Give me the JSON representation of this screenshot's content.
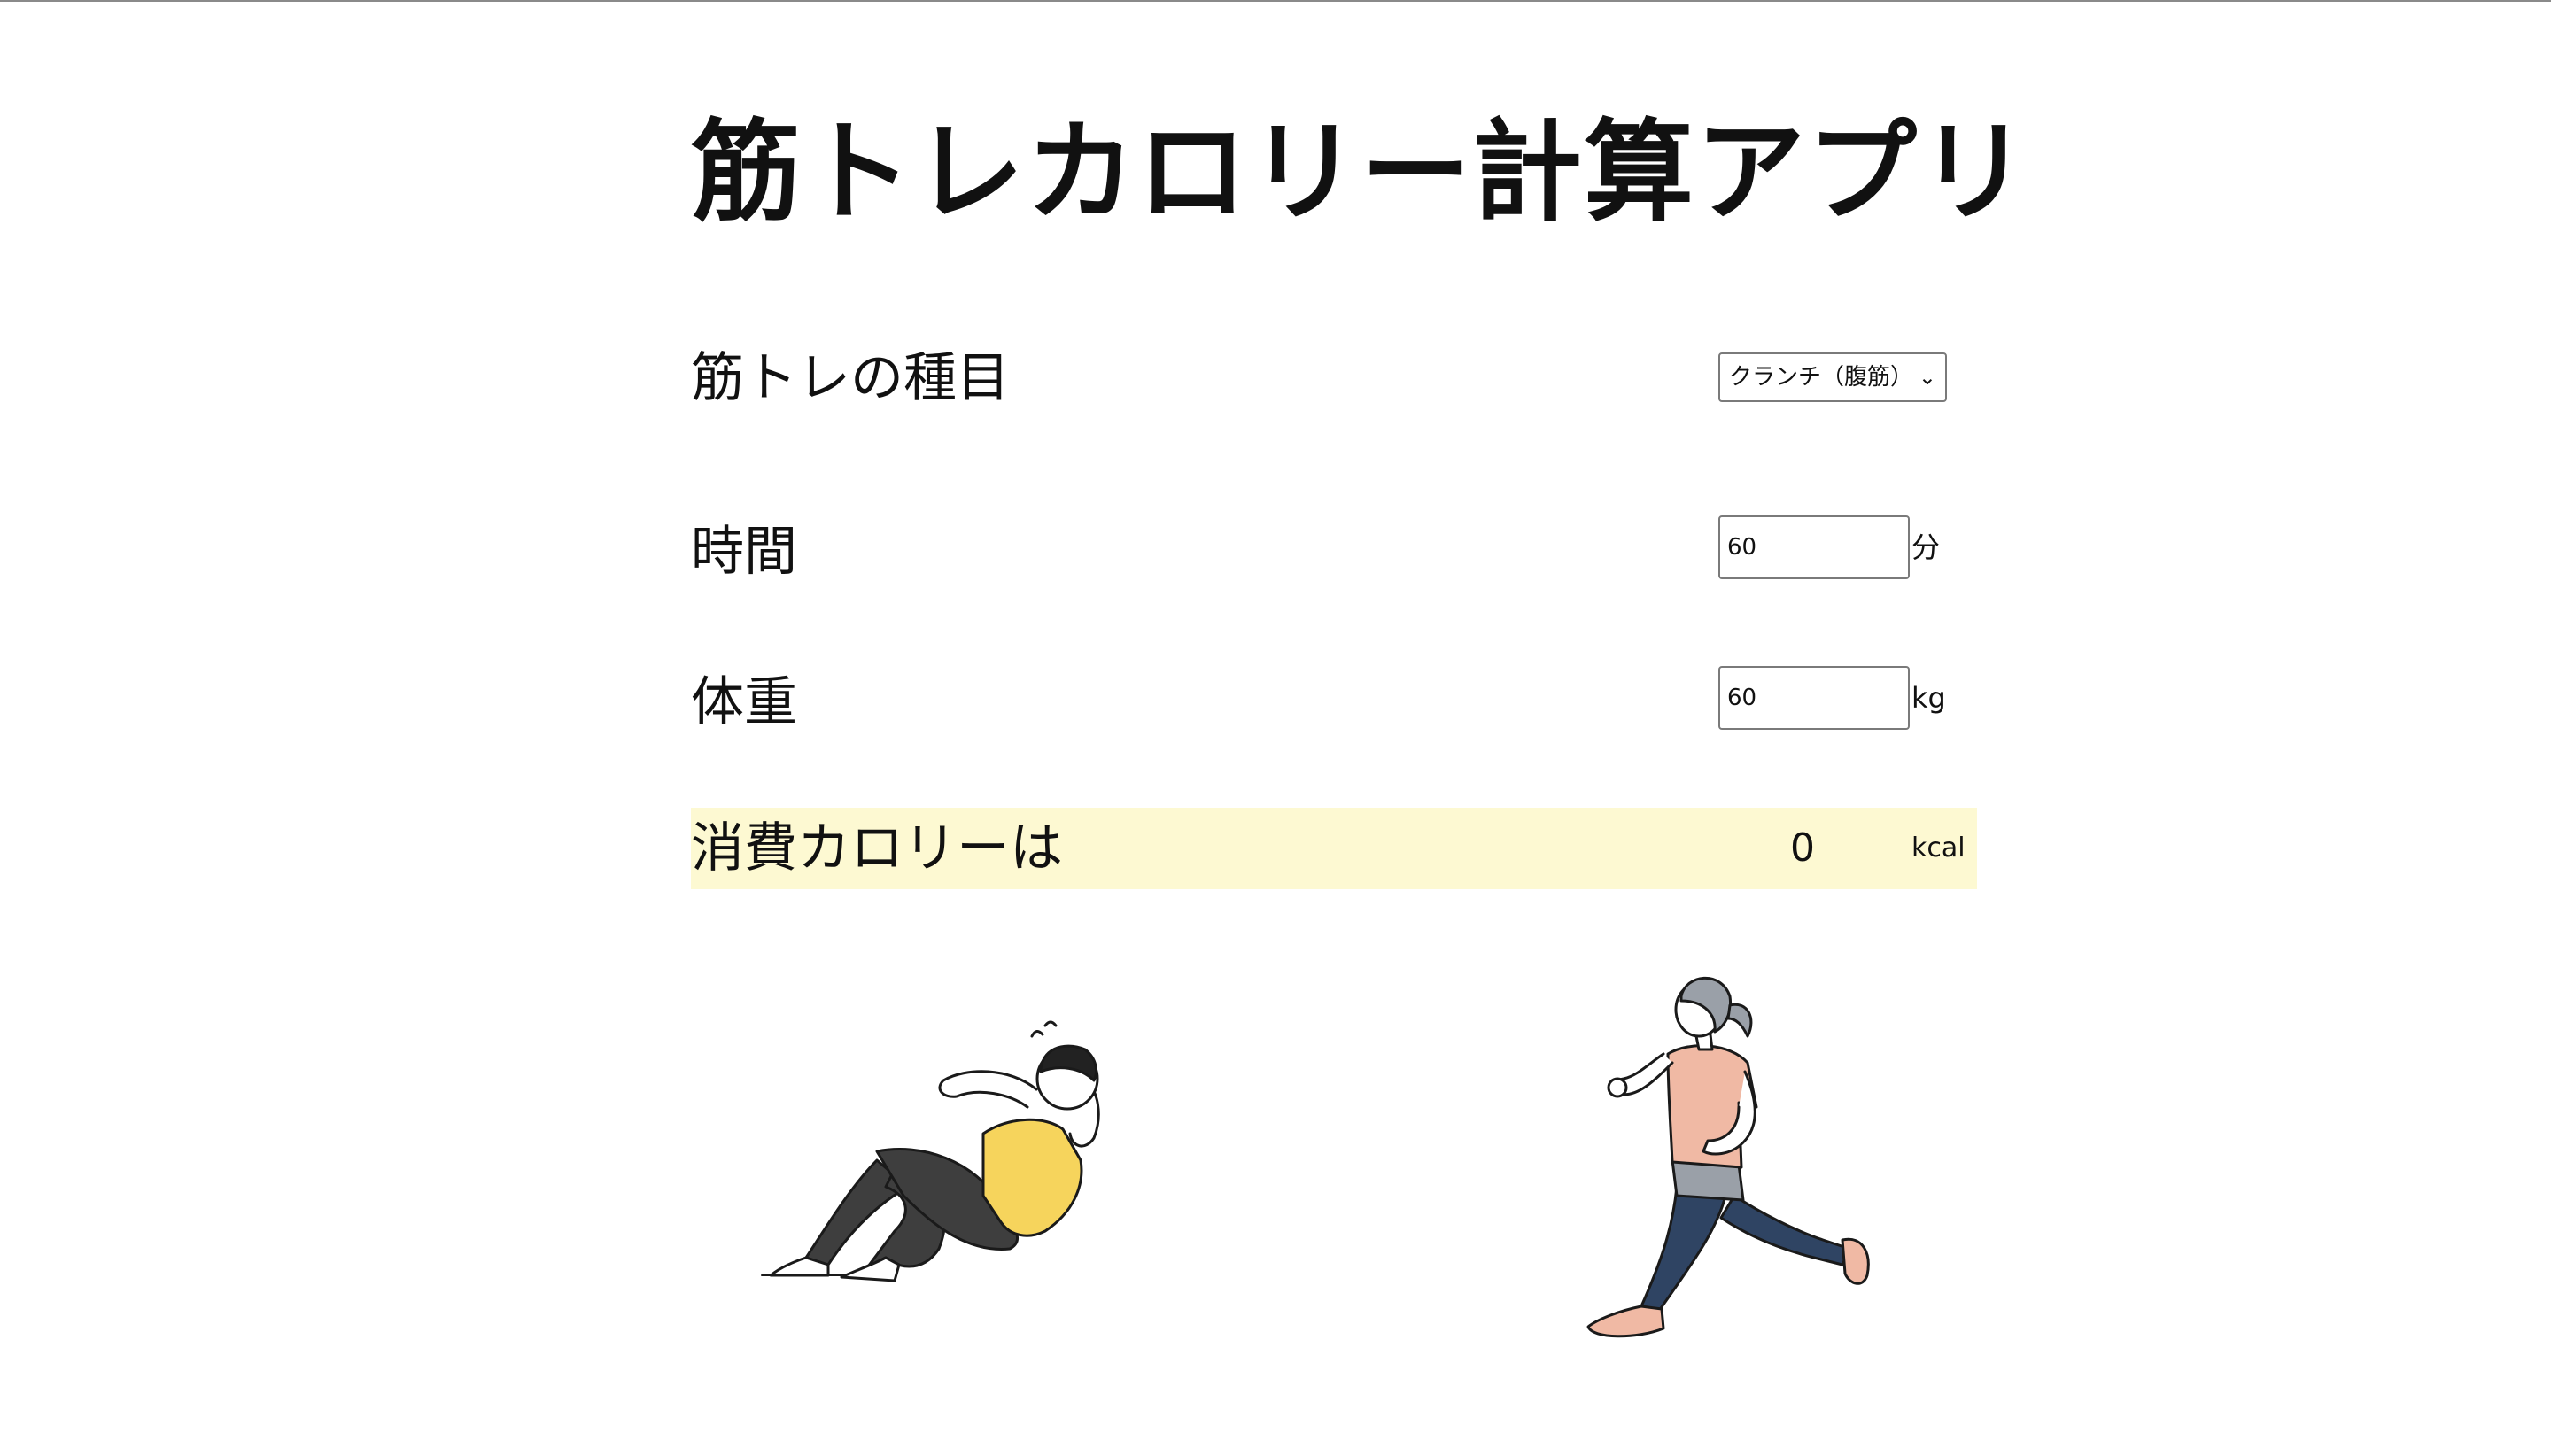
{
  "app": {
    "title": "筋トレカロリー計算アプリ"
  },
  "exercise": {
    "label": "筋トレの種目",
    "selected": "クランチ（腹筋）"
  },
  "duration": {
    "label": "時間",
    "value": "60",
    "unit": "分"
  },
  "weight": {
    "label": "体重",
    "value": "60",
    "unit": "kg"
  },
  "result": {
    "label": "消費カロリーは",
    "value": "0",
    "unit": "kcal"
  },
  "icons": {
    "select_arrow": "chevron-down-icon",
    "left_illustration": "crunch-exercise-illustration",
    "right_illustration": "running-woman-illustration"
  },
  "colors": {
    "result_background": "#fdf9d2",
    "shirt_yellow": "#f6d45c",
    "pants_dark": "#3e3e3e",
    "runner_shirt": "#f0b9a4",
    "runner_pants": "#2f4463"
  }
}
